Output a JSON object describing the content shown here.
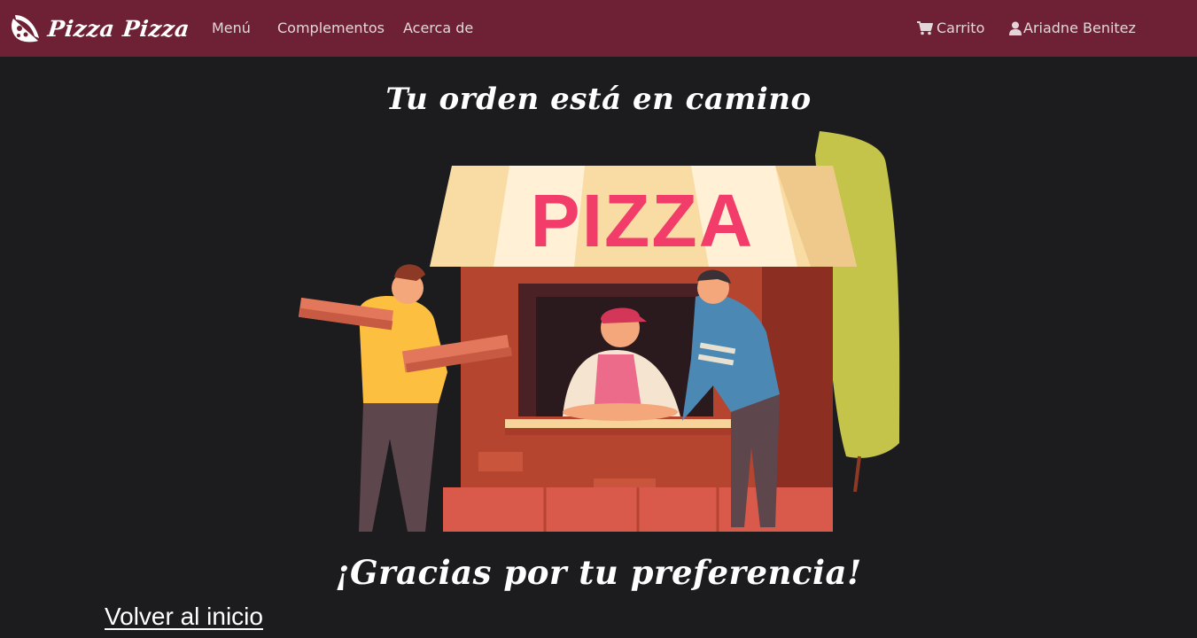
{
  "navbar": {
    "brand": "Pizza Pizza",
    "links": [
      "Menú",
      "Complementos",
      "Acerca de"
    ],
    "cart_label": "Carrito",
    "user_name": "Ariadne Benitez"
  },
  "main": {
    "title": "Tu orden está en camino",
    "illustration_sign": "PIZZA",
    "thanks": "¡Gracias por tu preferencia!",
    "back_link": "Volver al inicio"
  },
  "colors": {
    "navbar_bg": "#6e2134",
    "page_bg": "#1c1b1e",
    "sign_text": "#f23d6b"
  },
  "icons": {
    "brand": "pizza-slice-icon",
    "cart": "shopping-cart-icon",
    "user": "user-icon"
  }
}
